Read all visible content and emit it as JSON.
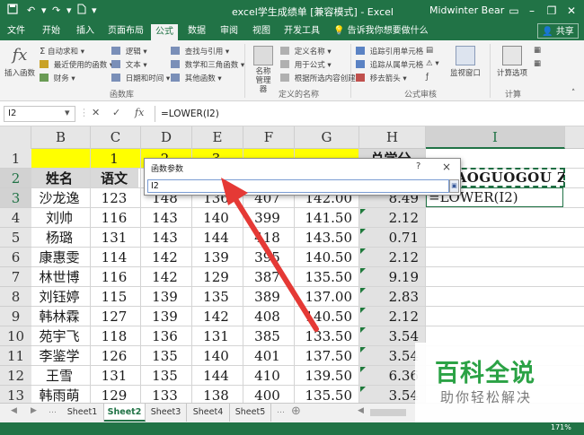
{
  "window": {
    "title": "excel学生成绩单 [兼容模式] - Excel",
    "user": "Midwinter Bear"
  },
  "tabs": [
    {
      "label": "文件"
    },
    {
      "label": "开始"
    },
    {
      "label": "插入"
    },
    {
      "label": "页面布局"
    },
    {
      "label": "公式",
      "active": true
    },
    {
      "label": "数据"
    },
    {
      "label": "审阅"
    },
    {
      "label": "视图"
    },
    {
      "label": "开发工具"
    }
  ],
  "tell_me": "告诉我你想要做什么",
  "share_label": "共享",
  "ribbon": {
    "insert_function": "插入函数",
    "autosum": "自动求和",
    "recent": "最近使用的函数",
    "financial": "财务",
    "logical": "逻辑",
    "text": "文本",
    "datetime": "日期和时间",
    "lookup": "查找与引用",
    "math": "数学和三角函数",
    "more": "其他函数",
    "library_group": "函数库",
    "name_manager": "名称管理器",
    "define_name": "定义名称",
    "use_in_formula": "用于公式",
    "create_from_sel": "根据所选内容创建",
    "names_group": "定义的名称",
    "trace_precedents": "追踪引用单元格",
    "trace_dependents": "追踪从属单元格",
    "remove_arrows": "移去箭头",
    "audit_group": "公式审核",
    "watch_window": "监视窗口",
    "calc_options": "计算选项",
    "calc_group": "计算"
  },
  "formula_bar": {
    "name_box": "I2",
    "fx": "fx",
    "formula": "=LOWER(I2)"
  },
  "columns": [
    "B",
    "C",
    "D",
    "E",
    "F",
    "G",
    "H",
    "I"
  ],
  "row_numbers": [
    "1",
    "2",
    "3",
    "4",
    "5",
    "6",
    "7",
    "8",
    "9",
    "10",
    "11",
    "12",
    "13"
  ],
  "sheet": {
    "row1": {
      "c": "1",
      "d": "2",
      "e": "3",
      "h": "总学分"
    },
    "row2": {
      "name": "姓名",
      "chinese": "语文",
      "i2": "XIAOGUOGOU ZHINAN"
    },
    "rows": [
      {
        "name": "沙龙逸",
        "c": "123",
        "d": "148",
        "e": "136",
        "f": "407",
        "g": "142.00",
        "h": "8.49"
      },
      {
        "name": "刘帅",
        "c": "116",
        "d": "143",
        "e": "140",
        "f": "399",
        "g": "141.50",
        "h": "2.12"
      },
      {
        "name": "杨璐",
        "c": "131",
        "d": "143",
        "e": "144",
        "f": "418",
        "g": "143.50",
        "h": "0.71"
      },
      {
        "name": "康惠雯",
        "c": "114",
        "d": "142",
        "e": "139",
        "f": "395",
        "g": "140.50",
        "h": "2.12"
      },
      {
        "name": "林世博",
        "c": "116",
        "d": "142",
        "e": "129",
        "f": "387",
        "g": "135.50",
        "h": "9.19"
      },
      {
        "name": "刘钰婷",
        "c": "115",
        "d": "139",
        "e": "135",
        "f": "389",
        "g": "137.00",
        "h": "2.83"
      },
      {
        "name": "韩林霖",
        "c": "127",
        "d": "139",
        "e": "142",
        "f": "408",
        "g": "140.50",
        "h": "2.12"
      },
      {
        "name": "苑宇飞",
        "c": "118",
        "d": "136",
        "e": "131",
        "f": "385",
        "g": "133.50",
        "h": "3.54"
      },
      {
        "name": "李鉴学",
        "c": "126",
        "d": "135",
        "e": "140",
        "f": "401",
        "g": "137.50",
        "h": "3.54"
      },
      {
        "name": "王雪",
        "c": "131",
        "d": "135",
        "e": "144",
        "f": "410",
        "g": "139.50",
        "h": "6.36"
      },
      {
        "name": "韩雨萌",
        "c": "129",
        "d": "133",
        "e": "138",
        "f": "400",
        "g": "135.50",
        "h": "3.54"
      }
    ],
    "editing_cell": "=LOWER(I2)"
  },
  "dialog": {
    "title": "函数参数",
    "help": "?",
    "close": "×",
    "input": "I2"
  },
  "sheet_tabs": [
    "Sheet1",
    "Sheet2",
    "Sheet3",
    "Sheet4",
    "Sheet5"
  ],
  "active_sheet": "Sheet2",
  "zoom": "171%",
  "watermark": {
    "title": "百科全说",
    "subtitle": "助你轻松解决"
  },
  "colors": {
    "accent": "#217346",
    "highlight_row": "#ffff00",
    "arrow": "#e53935",
    "watermark": "#2ba245"
  }
}
